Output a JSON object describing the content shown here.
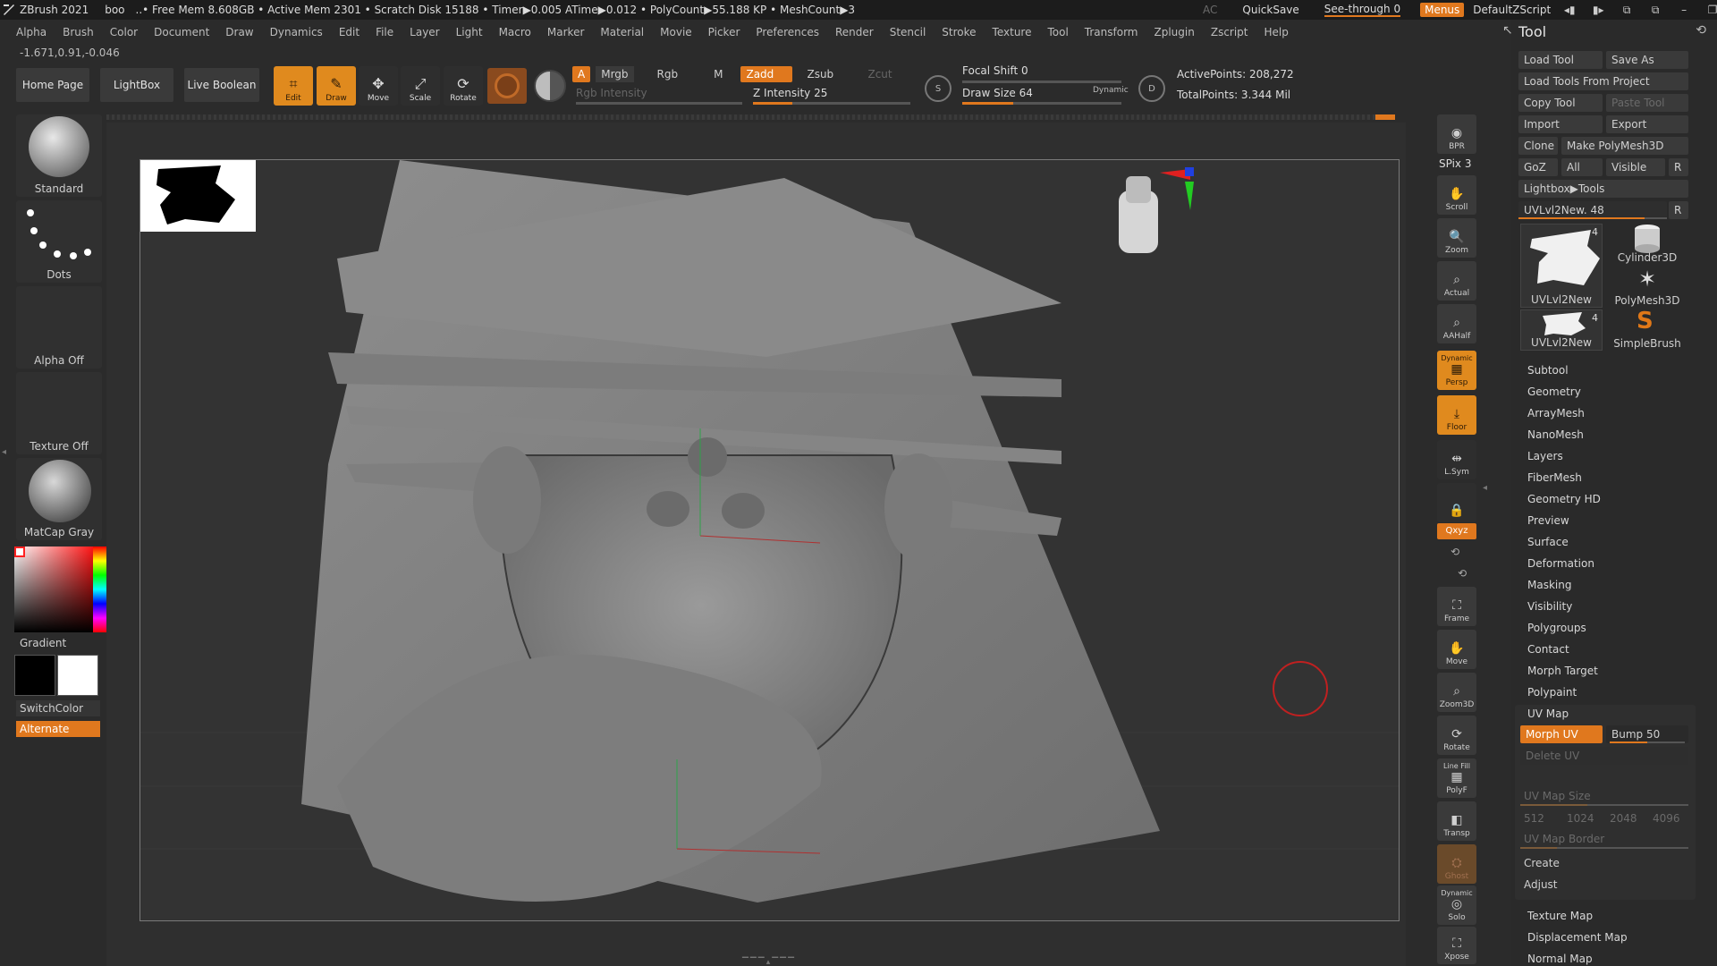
{
  "titlebar": {
    "app": "ZBrush 2021",
    "doc": "boo",
    "status": "..• Free Mem 8.608GB • Active Mem 2301 • Scratch Disk 15188 • Timer▶0.005 ATime▶0.012 • PolyCount▶55.188 KP • MeshCount▶3",
    "ac": "AC",
    "quicksave": "QuickSave",
    "seethrough": "See-through  0",
    "menus": "Menus",
    "script": "DefaultZScript"
  },
  "menubar": [
    "Alpha",
    "Brush",
    "Color",
    "Document",
    "Draw",
    "Dynamics",
    "Edit",
    "File",
    "Layer",
    "Light",
    "Macro",
    "Marker",
    "Material",
    "Movie",
    "Picker",
    "Preferences",
    "Render",
    "Stencil",
    "Stroke",
    "Texture",
    "Tool",
    "Transform",
    "Zplugin",
    "Zscript",
    "Help"
  ],
  "coords": "-1.671,0.91,-0.046",
  "toolbar": {
    "home": "Home Page",
    "lightbox": "LightBox",
    "liveboolean": "Live Boolean",
    "edit": "Edit",
    "draw": "Draw",
    "move": "Move",
    "scale": "Scale",
    "rotate": "Rotate",
    "a": "A",
    "mrgb": "Mrgb",
    "rgb": "Rgb",
    "m": "M",
    "zadd": "Zadd",
    "zsub": "Zsub",
    "zcut": "Zcut",
    "rgb_intensity": "Rgb Intensity",
    "z_intensity": "Z Intensity 25",
    "focal_shift": "Focal Shift 0",
    "draw_size": "Draw Size 64",
    "dynamic": "Dynamic",
    "active_points": "ActivePoints: 208,272",
    "total_points": "TotalPoints: 3.344 Mil",
    "s": "S",
    "d": "D"
  },
  "leftshelf": {
    "brush": "Standard",
    "stroke": "Dots",
    "alpha": "Alpha Off",
    "texture": "Texture Off",
    "material": "MatCap Gray",
    "gradient": "Gradient",
    "switchcolor": "SwitchColor",
    "alternate": "Alternate"
  },
  "rightbar": {
    "bpr": "BPR",
    "spix": "SPix 3",
    "scroll": "Scroll",
    "zoom": "Zoom",
    "actual": "Actual",
    "aahalf": "AAHalf",
    "dynamic": "Dynamic",
    "persp": "Persp",
    "floor": "Floor",
    "lsym": "L.Sym",
    "xyz": "Qxyz",
    "frame": "Frame",
    "move": "Move",
    "zoom3d": "Zoom3D",
    "rotate": "Rotate",
    "linefill": "Line Fill",
    "polyf": "PolyF",
    "transp": "Transp",
    "ghost": "Ghost",
    "solo_dyn": "Dynamic",
    "solo": "Solo",
    "xpose": "Xpose"
  },
  "toolpanel": {
    "title": "Tool",
    "buttons": {
      "load_tool": "Load Tool",
      "save_as": "Save As",
      "load_from_project": "Load Tools From Project",
      "copy_tool": "Copy Tool",
      "paste_tool": "Paste Tool",
      "import": "Import",
      "export": "Export",
      "clone": "Clone",
      "make_polymesh": "Make PolyMesh3D",
      "goz": "GoZ",
      "all": "All",
      "visible": "Visible",
      "r": "R",
      "lightbox_tools": "Lightbox▶Tools",
      "uvlvl": "UVLvl2New. 48",
      "r2": "R"
    },
    "thumbs": [
      {
        "label": "UVLvl2New",
        "badge": ""
      },
      {
        "label": "Cylinder3D",
        "badge": ""
      },
      {
        "label": "PolyMesh3D",
        "badge": ""
      },
      {
        "label": "UVLvl2New",
        "badge": "4"
      },
      {
        "label": "SimpleBrush",
        "badge": ""
      }
    ],
    "thumb_badge_big": "4",
    "sections": [
      "Subtool",
      "Geometry",
      "ArrayMesh",
      "NanoMesh",
      "Layers",
      "FiberMesh",
      "Geometry HD",
      "Preview",
      "Surface",
      "Deformation",
      "Masking",
      "Visibility",
      "Polygroups",
      "Contact",
      "Morph Target",
      "Polypaint"
    ],
    "uvmap": {
      "title": "UV Map",
      "morph_uv": "Morph UV",
      "bump": "Bump 50",
      "delete_uv": "Delete UV",
      "uv_map_size": "UV Map Size",
      "sizes": [
        "512",
        "1024",
        "2048",
        "4096"
      ],
      "uv_map_border": "UV Map Border",
      "create": "Create",
      "adjust": "Adjust"
    },
    "sections_after": [
      "Texture Map",
      "Displacement Map",
      "Normal Map"
    ]
  }
}
